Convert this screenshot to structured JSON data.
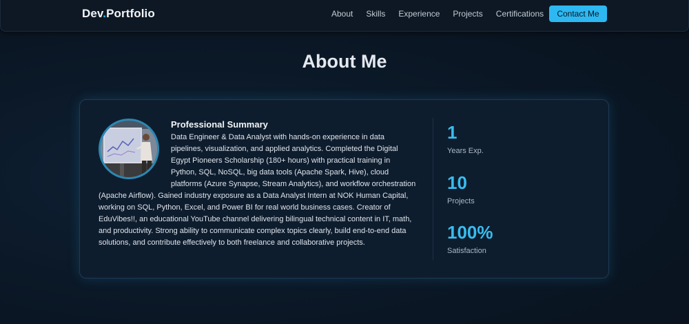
{
  "brand": {
    "name_part1": "Dev",
    "dot": ".",
    "name_part2": "Portfolio"
  },
  "nav": {
    "links": [
      "About",
      "Skills",
      "Experience",
      "Projects",
      "Certifications"
    ],
    "contact_label": "Contact Me"
  },
  "about": {
    "title": "About Me",
    "summary_title": "Professional Summary",
    "summary_text": "Data Engineer & Data Analyst with hands-on experience in data pipelines, visualization, and applied analytics. Completed the Digital Egypt Pioneers Scholarship (180+ hours) with practical training in Python, SQL, NoSQL, big data tools (Apache Spark, Hive), cloud platforms (Azure Synapse, Stream Analytics), and workflow orchestration (Apache Airflow). Gained industry exposure as a Data Analyst Intern at NOK Human Capital, working on SQL, Python, Excel, and Power BI for real world business cases. Creator of EduVibes!!, an educational YouTube channel delivering bilingual technical content in IT, math, and productivity. Strong ability to communicate complex topics clearly, build end-to-end data solutions, and contribute effectively to both freelance and collaborative projects.",
    "stats": [
      {
        "value": "1",
        "label": "Years Exp."
      },
      {
        "value": "10",
        "label": "Projects"
      },
      {
        "value": "100%",
        "label": "Satisfaction"
      }
    ]
  },
  "colors": {
    "accent": "#2db8f2",
    "background": "#0b1827",
    "card": "#0e1d2e",
    "stat_value": "#38bdf0"
  }
}
